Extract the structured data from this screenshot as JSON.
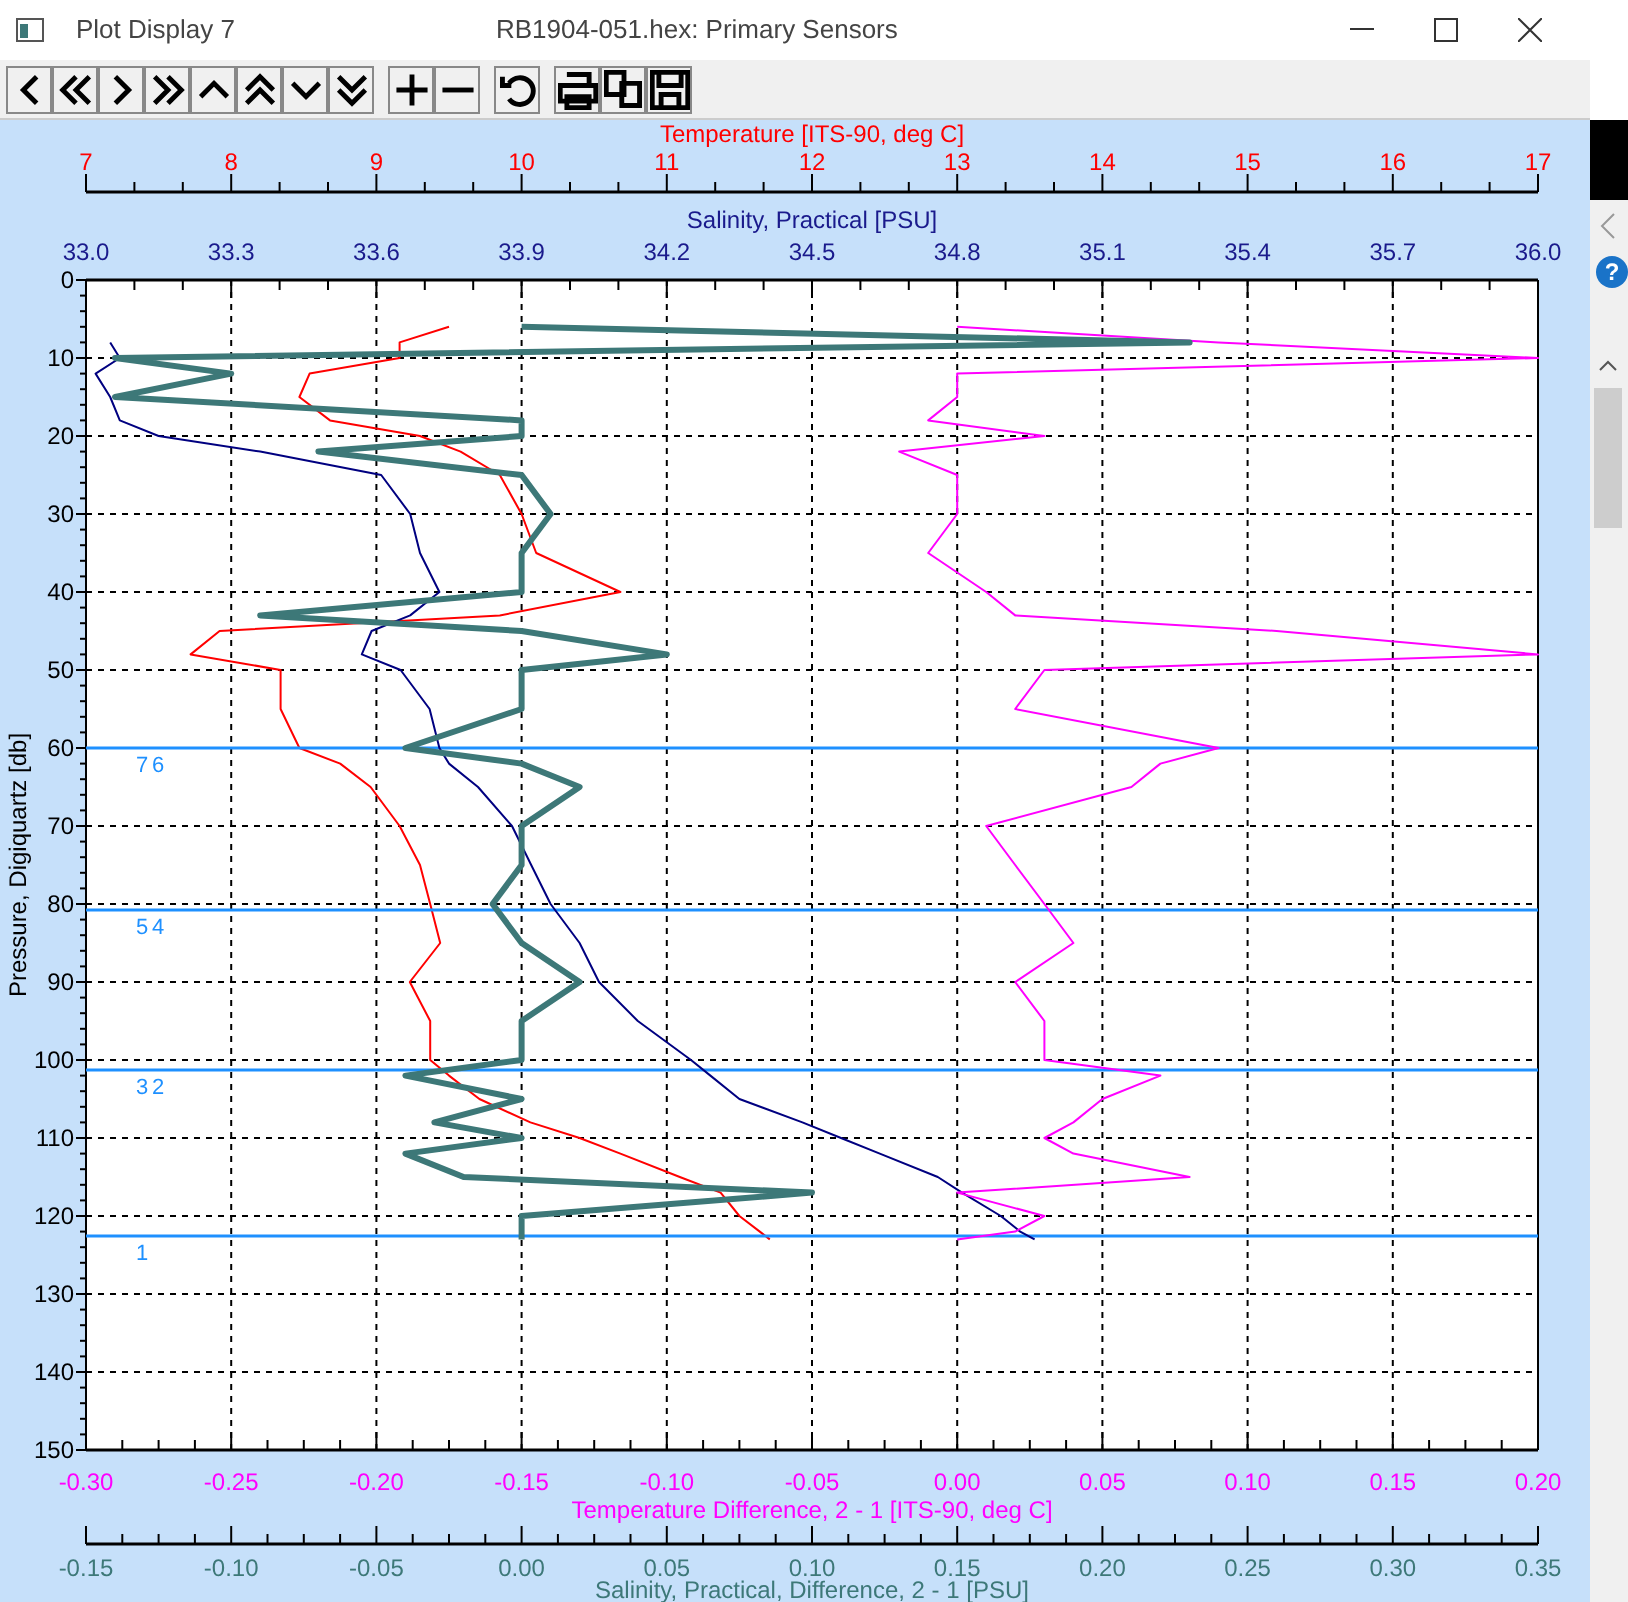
{
  "window": {
    "title": "Plot Display 7",
    "document_title": "RB1904-051.hex: Primary Sensors"
  },
  "background_window": {
    "help_text": "?"
  },
  "plot": {
    "temperature_chart": {
      "chart_data": {
        "type": "line",
        "grid": true,
        "xlabel": "Temperature [ITS-90, deg C]",
        "ylabel": "Pressure, Digiquartz [db]",
        "xlim": [
          7,
          17
        ],
        "ylim": [
          150,
          0
        ],
        "xticks": [
          7,
          8,
          9,
          10,
          11,
          12,
          13,
          14,
          15,
          16,
          17
        ],
        "yticks": [
          0,
          10,
          20,
          30,
          40,
          50,
          60,
          70,
          80,
          90,
          100,
          110,
          120,
          130,
          140,
          150
        ],
        "x": [
          9.5,
          9.16,
          9.16,
          8.54,
          8.47,
          8.68,
          9.3,
          9.58,
          9.85,
          10.0,
          10.1,
          10.68,
          9.85,
          7.92,
          7.72,
          8.34,
          8.34,
          8.47,
          8.75,
          8.96,
          9.16,
          9.3,
          9.37,
          9.44,
          9.23,
          9.37,
          9.37,
          9.5,
          9.71,
          10.06,
          10.4,
          10.68,
          11.09,
          11.37,
          11.5,
          11.64,
          11.71
        ],
        "series": [
          {
            "color": "#ff0000",
            "values": [
              6,
              8,
              10,
              12,
              15,
              18,
              20,
              22,
              25,
              30,
              35,
              40,
              43,
              45,
              48,
              50,
              55,
              60,
              62,
              65,
              70,
              75,
              80,
              85,
              90,
              95,
              100,
              102,
              105,
              108,
              110,
              112,
              115,
              117,
              120,
              122,
              123
            ]
          }
        ]
      }
    },
    "bottle_markers": [
      {
        "label": "7"
      },
      {
        "label": "6"
      },
      {
        "label": "5"
      },
      {
        "label": "4"
      },
      {
        "label": "3"
      },
      {
        "label": "2"
      },
      {
        "label": "1"
      }
    ],
    "salinity_chart": {
      "chart_data": {
        "type": "line",
        "xlabel": "Salinity, Practical [PSU]",
        "xlim": [
          33,
          36
        ],
        "ylim": [
          150,
          0
        ],
        "xticks": [
          {
            "value": 33,
            "label": "33.0"
          },
          {
            "value": 33.3,
            "label": "33.3"
          },
          {
            "value": 33.6,
            "label": "33.6"
          },
          {
            "value": 33.9,
            "label": "33.9"
          },
          {
            "value": 34.2,
            "label": "34.2"
          },
          {
            "value": 34.5,
            "label": "34.5"
          },
          {
            "value": 34.8,
            "label": "34.8"
          },
          {
            "value": 35.1,
            "label": "35.1"
          },
          {
            "value": 35.4,
            "label": "35.4"
          },
          {
            "value": 35.7,
            "label": "35.7"
          },
          {
            "value": 36,
            "label": "36.0"
          }
        ],
        "x": [
          33.05,
          33.07,
          33.02,
          33.05,
          33.07,
          33.15,
          33.36,
          33.61,
          33.67,
          33.69,
          33.73,
          33.67,
          33.59,
          33.57,
          33.65,
          33.71,
          33.73,
          33.75,
          33.81,
          33.88,
          33.92,
          33.96,
          34.02,
          34.06,
          34.14,
          34.25,
          34.29,
          34.35,
          34.48,
          34.56,
          34.64,
          34.76,
          34.81,
          34.89,
          34.93,
          34.96
        ],
        "series": [
          {
            "color": "#000080",
            "values": [
              8,
              10,
              12,
              15,
              18,
              20,
              22,
              25,
              30,
              35,
              40,
              43,
              45,
              48,
              50,
              55,
              60,
              62,
              65,
              70,
              75,
              80,
              85,
              90,
              95,
              100,
              102,
              105,
              108,
              110,
              112,
              115,
              117,
              120,
              122,
              123
            ]
          }
        ]
      }
    },
    "temperature_difference_chart": {
      "chart_data": {
        "type": "line",
        "xlabel": "Temperature Difference, 2 - 1 [ITS-90, deg C]",
        "xlim": [
          -0.3,
          0.2
        ],
        "ylim": [
          150,
          0
        ],
        "xticks": [
          {
            "value": -0.3,
            "label": "-0.30"
          },
          {
            "value": -0.25,
            "label": "-0.25"
          },
          {
            "value": -0.2,
            "label": "-0.20"
          },
          {
            "value": -0.15,
            "label": "-0.15"
          },
          {
            "value": -0.1,
            "label": "-0.10"
          },
          {
            "value": -0.05,
            "label": "-0.05"
          },
          {
            "value": 0,
            "label": "0.00"
          },
          {
            "value": 0.05,
            "label": "0.05"
          },
          {
            "value": 0.1,
            "label": "0.10"
          },
          {
            "value": 0.15,
            "label": "0.15"
          },
          {
            "value": 0.2,
            "label": "0.20"
          }
        ],
        "x": [
          0.0,
          0.09,
          0.2,
          0.0,
          0.0,
          -0.01,
          0.03,
          -0.02,
          0.0,
          0.0,
          -0.01,
          0.01,
          0.02,
          0.11,
          0.2,
          0.03,
          0.02,
          0.09,
          0.07,
          0.06,
          0.01,
          0.02,
          0.03,
          0.04,
          0.02,
          0.03,
          0.03,
          0.07,
          0.05,
          0.04,
          0.03,
          0.04,
          0.08,
          0.0,
          0.03,
          0.02,
          0.0
        ],
        "series": [
          {
            "color": "#ff00ff",
            "values": [
              6,
              8,
              10,
              12,
              15,
              18,
              20,
              22,
              25,
              30,
              35,
              40,
              43,
              45,
              48,
              50,
              55,
              60,
              62,
              65,
              70,
              75,
              80,
              85,
              90,
              95,
              100,
              102,
              105,
              108,
              110,
              112,
              115,
              117,
              120,
              122,
              123
            ]
          }
        ]
      }
    },
    "salinity_difference_chart": {
      "chart_data": {
        "type": "line",
        "xlabel": "Salinity, Practical, Difference, 2 - 1 [PSU]",
        "xlim": [
          -0.15,
          0.35
        ],
        "ylim": [
          150,
          0
        ],
        "xticks": [
          {
            "value": -0.15,
            "label": "-0.15"
          },
          {
            "value": -0.1,
            "label": "-0.10"
          },
          {
            "value": -0.05,
            "label": "-0.05"
          },
          {
            "value": 0,
            "label": "0.00"
          },
          {
            "value": 0.05,
            "label": "0.05"
          },
          {
            "value": 0.1,
            "label": "0.10"
          },
          {
            "value": 0.15,
            "label": "0.15"
          },
          {
            "value": 0.2,
            "label": "0.20"
          },
          {
            "value": 0.25,
            "label": "0.25"
          },
          {
            "value": 0.3,
            "label": "0.30"
          },
          {
            "value": 0.35,
            "label": "0.35"
          }
        ],
        "x": [
          0.0,
          0.23,
          -0.14,
          -0.1,
          -0.14,
          0.0,
          0.0,
          -0.07,
          0.0,
          0.01,
          0.0,
          0.0,
          -0.09,
          0.0,
          0.05,
          0.0,
          0.0,
          -0.04,
          0.0,
          0.02,
          0.0,
          0.0,
          -0.01,
          0.0,
          0.02,
          0.0,
          0.0,
          -0.04,
          0.0,
          -0.03,
          0.0,
          -0.04,
          -0.02,
          0.1,
          0.0,
          0.0,
          0.0
        ],
        "series": [
          {
            "color": "#3d7878",
            "values": [
              6,
              8,
              10,
              12,
              15,
              18,
              20,
              22,
              25,
              30,
              35,
              40,
              43,
              45,
              48,
              50,
              55,
              60,
              62,
              65,
              70,
              75,
              80,
              85,
              90,
              95,
              100,
              102,
              105,
              108,
              110,
              112,
              115,
              117,
              120,
              122,
              123
            ]
          }
        ]
      }
    }
  }
}
